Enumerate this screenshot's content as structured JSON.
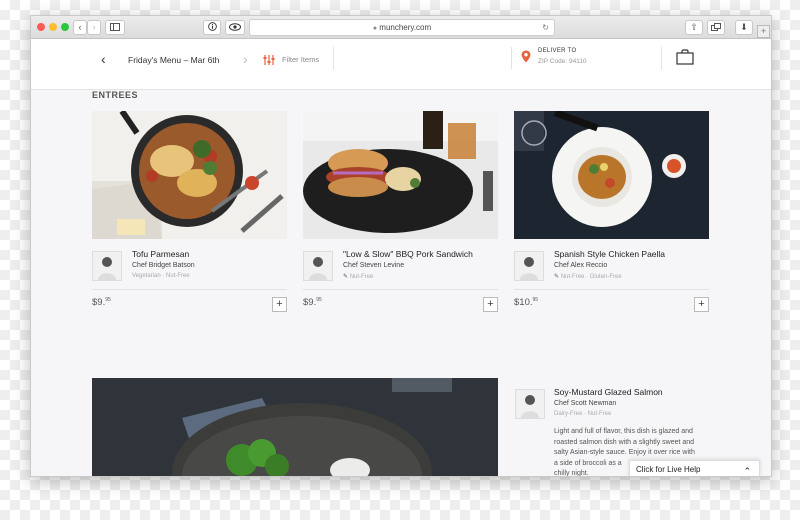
{
  "browser": {
    "url": "munchery.com",
    "back_glyph": "‹",
    "forward_glyph": "›",
    "reload_glyph": "↻",
    "share_glyph": "⇧",
    "download_glyph": "⬇"
  },
  "header": {
    "back_glyph": "‹",
    "menu_title": "Friday's Menu – Mar 6th",
    "next_glyph": "›",
    "filter_label": "Filter Items",
    "deliver_to_label": "DELIVER TO",
    "zip_text": "ZIP Code: 94110"
  },
  "section_title": "ENTREES",
  "cards": [
    {
      "name": "Tofu Parmesan",
      "chef": "Chef Bridget Batson",
      "tags": "Vegetarian · Nut-Free",
      "price_main": "$9.",
      "price_cents": "95"
    },
    {
      "name": "\"Low & Slow\" BBQ Pork Sandwich",
      "chef": "Chef Steven Levine",
      "tags": "Nut-Free",
      "price_main": "$9.",
      "price_cents": "95"
    },
    {
      "name": "Spanish Style Chicken Paella",
      "chef": "Chef Alex Reccio",
      "tags": "Nut-Free · Gluten-Free",
      "price_main": "$10.",
      "price_cents": "95"
    }
  ],
  "add_glyph": "+",
  "featured": {
    "name": "Soy-Mustard Glazed Salmon",
    "chef": "Chef Scott Newman",
    "tags": "Dairy-Free · Nut-Free",
    "description": [
      "Light and full of flavor, this dish is glazed and",
      "roasted salmon dish with a slightly sweet and",
      "salty Asian-style sauce. Enjoy it over rice with",
      "a side of broccoli as a",
      "chilly night."
    ]
  },
  "help": {
    "label": "Click for Live Help",
    "chevron": "⌃"
  },
  "colors": {
    "accent": "#e8623f",
    "background": "#f6f6f8"
  }
}
